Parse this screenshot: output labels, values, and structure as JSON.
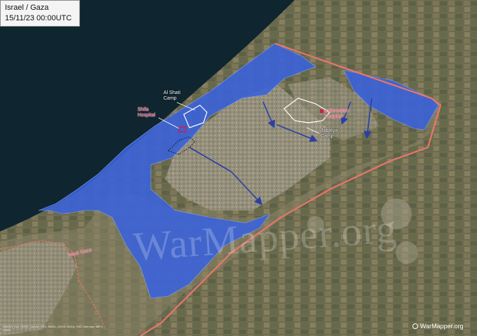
{
  "title": {
    "region": "Israel / Gaza",
    "datetime": "15/11/23 00:00UTC"
  },
  "labels": {
    "al_shati": [
      "Al Shati",
      "Camp"
    ],
    "shifa": [
      "Shifa",
      "Hospital"
    ],
    "indonesian": [
      "Indonesian",
      "Hospital"
    ],
    "jabalya": [
      "Jabalya",
      "Camp"
    ],
    "wadi_gaza": "Wadi Gaza"
  },
  "watermark": "WarMapper.org",
  "brand": "WarMapper.org",
  "credits": "NADER, Esri, HERE, Garmin, ESO, NASA, USGS, NASA, FAO, Intermap, METI, USDA",
  "colors": {
    "sea": "#0f2530",
    "idf_control": "#3b63d9",
    "border": "#e8766a",
    "arrow": "#2b3fa8",
    "marker": "#cc1f4a"
  }
}
